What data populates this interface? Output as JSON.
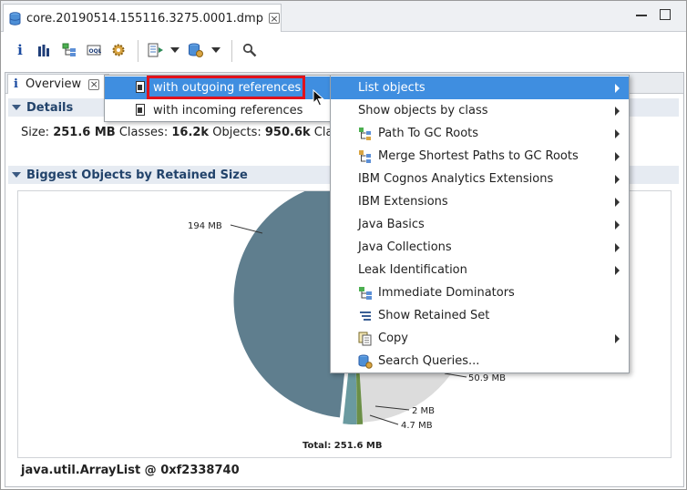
{
  "editor": {
    "tab_title": "core.20190514.155116.3275.0001.dmp"
  },
  "toolbar": {
    "icons": [
      "info-icon",
      "histogram-icon",
      "dominator-tree-icon",
      "oql-icon",
      "gear-icon",
      "report-icon",
      "query-icon",
      "search-icon"
    ]
  },
  "view": {
    "tab_label": "Overview"
  },
  "details": {
    "heading": "Details",
    "size_label": "Size:",
    "size_value": "251.6 MB",
    "classes_label": "Classes:",
    "classes_value": "16.2k",
    "objects_label": "Objects:",
    "objects_value": "950.6k",
    "trailing": "Cla"
  },
  "biggest": {
    "heading": "Biggest Objects by Retained Size",
    "selected_object": "java.util.ArrayList @ 0xf2338740"
  },
  "chart_data": {
    "type": "pie",
    "title": "",
    "total_label": "Total: 251.6 MB",
    "slices": [
      {
        "label": "194 MB",
        "value": 194,
        "color": "#5f7e8e"
      },
      {
        "label": "50.9 MB",
        "value": 50.9,
        "color": "#dcdcdc"
      },
      {
        "label": "2 MB",
        "value": 2,
        "color": "#6b8f47"
      },
      {
        "label": "4.7 MB",
        "value": 4.7,
        "color": "#6a9aa0"
      }
    ]
  },
  "submenu": {
    "items": [
      {
        "label": "with outgoing references",
        "active": true
      },
      {
        "label": "with incoming references",
        "active": false
      }
    ]
  },
  "context_menu": {
    "items": [
      {
        "label": "List objects",
        "has_submenu": true,
        "icon": "",
        "active": true
      },
      {
        "label": "Show objects by class",
        "has_submenu": true,
        "icon": ""
      },
      {
        "label": "Path To GC Roots",
        "has_submenu": true,
        "icon": "path-to-gc-roots-icon"
      },
      {
        "label": "Merge Shortest Paths to GC Roots",
        "has_submenu": true,
        "icon": "merge-paths-icon"
      },
      {
        "label": "IBM Cognos Analytics Extensions",
        "has_submenu": true,
        "icon": ""
      },
      {
        "label": "IBM Extensions",
        "has_submenu": true,
        "icon": ""
      },
      {
        "label": "Java Basics",
        "has_submenu": true,
        "icon": ""
      },
      {
        "label": "Java Collections",
        "has_submenu": true,
        "icon": ""
      },
      {
        "label": "Leak Identification",
        "has_submenu": true,
        "icon": ""
      },
      {
        "label": "Immediate Dominators",
        "has_submenu": false,
        "icon": "immediate-dominators-icon"
      },
      {
        "label": "Show Retained Set",
        "has_submenu": false,
        "icon": "retained-set-icon"
      },
      {
        "label": "Copy",
        "has_submenu": true,
        "icon": "copy-icon"
      },
      {
        "label": "Search Queries...",
        "has_submenu": false,
        "icon": "search-queries-icon"
      }
    ]
  }
}
